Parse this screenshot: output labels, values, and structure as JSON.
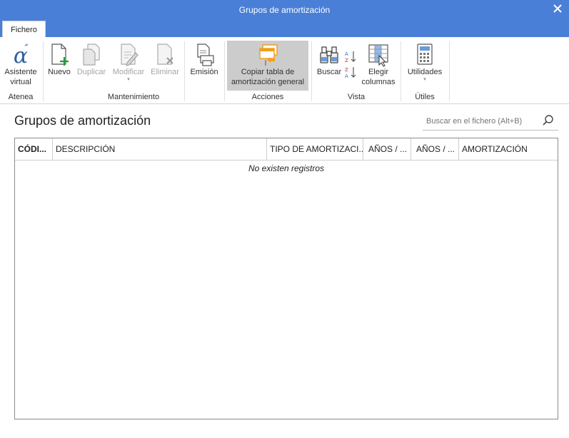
{
  "window": {
    "title": "Grupos de amortización"
  },
  "ribbon": {
    "tab": "Fichero",
    "groups": {
      "atenea": "Atenea",
      "mantenimiento": "Mantenimiento",
      "acciones": "Acciones",
      "vista": "Vista",
      "utiles": "Útiles"
    },
    "buttons": {
      "asistente_1": "Asistente",
      "asistente_2": "virtual",
      "nuevo": "Nuevo",
      "duplicar": "Duplicar",
      "modificar": "Modificar",
      "eliminar": "Eliminar",
      "emision": "Emisión",
      "copiar_1": "Copiar tabla de",
      "copiar_2": "amortización general",
      "buscar": "Buscar",
      "elegir_1": "Elegir",
      "elegir_2": "columnas",
      "utilidades": "Utilidades"
    }
  },
  "main": {
    "title": "Grupos de amortización",
    "search_placeholder": "Buscar en el fichero (Alt+B)",
    "columns": [
      "CÓDI...",
      "DESCRIPCIÓN",
      "TIPO DE AMORTIZACI...",
      "AÑOS / ...",
      "AÑOS / ...",
      "AMORTIZACIÓN"
    ],
    "empty_message": "No existen registros"
  },
  "colors": {
    "titlebar": "#4a7fd8",
    "accent_green": "#1e9e3a",
    "accent_orange": "#f0a020"
  },
  "icons": [
    "close-icon",
    "alpha-icon",
    "new-document-icon",
    "duplicate-icon",
    "edit-icon",
    "delete-icon",
    "print-icon",
    "copy-table-icon",
    "binoculars-icon",
    "sort-az-icon",
    "sort-za-icon",
    "columns-icon",
    "calculator-icon",
    "search-icon"
  ]
}
